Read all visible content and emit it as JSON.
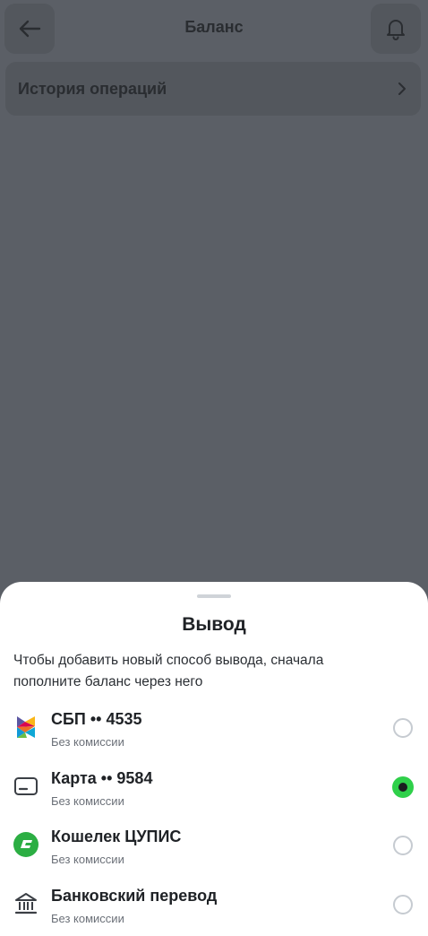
{
  "header": {
    "title": "Баланс",
    "back_icon": "arrow-left-icon",
    "notifications_icon": "bell-icon"
  },
  "history": {
    "label": "История операций",
    "icon": "chevron-right-icon"
  },
  "sheet": {
    "title": "Вывод",
    "description": "Чтобы добавить новый способ вывода, сначала пополните баланс через него",
    "methods": [
      {
        "name": "СБП •• 4535",
        "subtitle": "Без комиссии",
        "icon": "sbp-logo-icon",
        "selected": false
      },
      {
        "name": "Карта •• 9584",
        "subtitle": "Без комиссии",
        "icon": "card-icon",
        "selected": true
      },
      {
        "name": "Кошелек ЦУПИС",
        "subtitle": "Без комиссии",
        "icon": "cupis-wallet-icon",
        "selected": false
      },
      {
        "name": "Банковский перевод",
        "subtitle": "Без комиссии",
        "icon": "bank-icon",
        "selected": false
      }
    ]
  },
  "colors": {
    "overlay": "#5b5f66",
    "accent_green": "#2fd04a",
    "sheet_bg": "#ffffff"
  }
}
